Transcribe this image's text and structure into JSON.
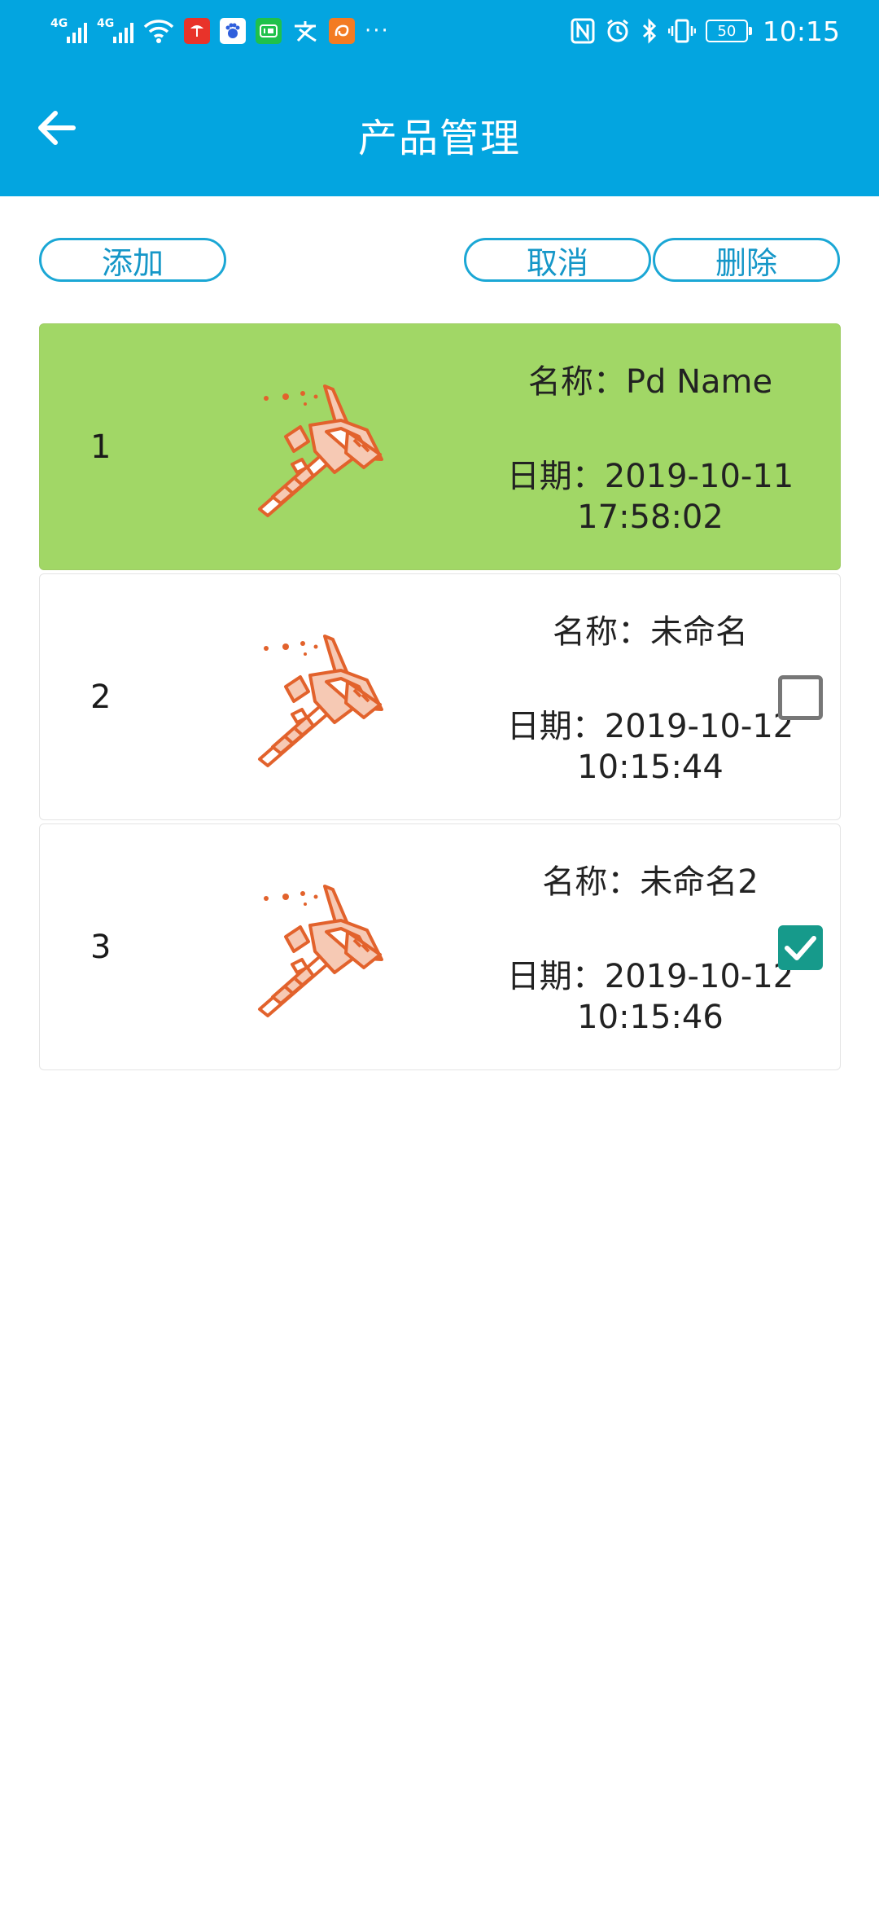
{
  "status_bar": {
    "network_1": "4G",
    "network_2": "4G",
    "battery_level": "50",
    "time": "10:15",
    "more": "···"
  },
  "header": {
    "title": "产品管理"
  },
  "toolbar": {
    "add_label": "添加",
    "cancel_label": "取消",
    "delete_label": "删除"
  },
  "products": [
    {
      "index": "1",
      "name": "名称：Pd Name",
      "date_line1": "日期：2019-10-11",
      "date_line2": "17:58:02",
      "selected": true
    },
    {
      "index": "2",
      "name": "名称：未命名",
      "date_line1": "日期：2019-10-12",
      "date_line2": "10:15:44",
      "checked": false
    },
    {
      "index": "3",
      "name": "名称：未命名2",
      "date_line1": "日期：2019-10-12",
      "date_line2": "10:15:46",
      "checked": true
    }
  ],
  "colors": {
    "header": "#03A5E0",
    "selected_row": "#A1D766",
    "pill_border": "#1BA7D5",
    "checkbox_on": "#169A8B",
    "icon": "#E2622C"
  },
  "icons": {
    "back": "arrow-left-icon",
    "product": "vernier-caliper-icon",
    "checked": "check-icon"
  }
}
